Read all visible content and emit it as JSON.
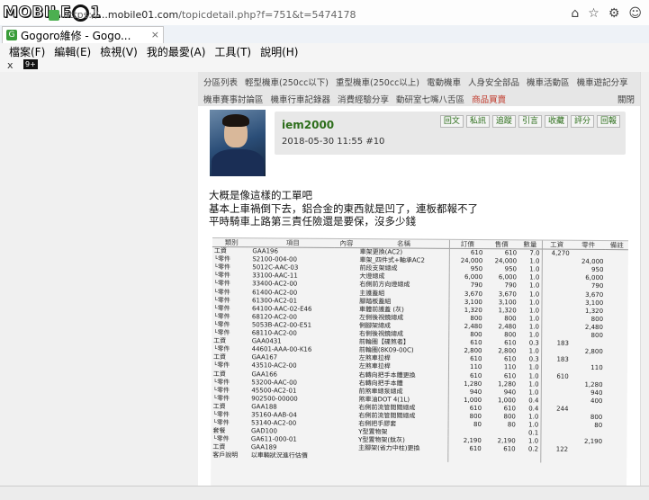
{
  "browser": {
    "logo": {
      "left": "MOBILE",
      "right": "1"
    },
    "url_prefix": "https://",
    "url_domain": "...mobile01.com",
    "url_path": "/topicdetail.php?f=751&t=5474178",
    "tab_title": "Gogoro維修 - Gogo...",
    "tab_close": "×",
    "nav_icons": [
      "home-icon",
      "star-icon",
      "gear-icon",
      "smiley-icon"
    ],
    "menu": [
      "檔案(F)",
      "編輯(E)",
      "檢視(V)",
      "我的最愛(A)",
      "工具(T)",
      "說明(H)"
    ],
    "toolbar_x": "x",
    "toolbar_badge": "9+"
  },
  "forum_nav": {
    "row1": [
      "分區列表",
      "輕型機車(250cc以下)",
      "重型機車(250cc以上)",
      "電動機車",
      "人身安全部品",
      "機車活動區",
      "機車遊記分享"
    ],
    "row2": [
      "機車賽事討論區",
      "機車行車記錄器",
      "消費經驗分享",
      "動研室七嘴八舌區"
    ],
    "row2_highlight": "商品買賣",
    "manage": "關閉"
  },
  "post": {
    "username": "iem2000",
    "datetime": "2018-05-30 11:55",
    "floor": "#10",
    "actions": [
      "回文",
      "私訊",
      "追蹤",
      "引言",
      "收藏",
      "評分",
      "回報"
    ],
    "body": [
      "大概是像這樣的工單吧",
      "基本上車禍倒下去，鋁合金的東西就是凹了，連板都報不了",
      "平時騎車上路第三責任險還是要保，沒多少錢"
    ]
  },
  "scan": {
    "header": [
      "類別",
      "項目",
      "內容",
      "名稱",
      "訂價",
      "售價",
      "數量",
      "工資",
      "零件",
      "備註"
    ],
    "rows": [
      [
        "工資",
        "GAA196",
        "",
        "車架更換(AC2)",
        "610",
        "610",
        "7.0",
        "4,270",
        "",
        ""
      ],
      [
        "└零件",
        "S2100-004-00",
        "",
        "車架_四件式+軸承AC2",
        "24,000",
        "24,000",
        "1.0",
        "",
        "24,000",
        ""
      ],
      [
        "└零件",
        "5012C-AAC-03",
        "",
        "前段支架總成",
        "950",
        "950",
        "1.0",
        "",
        "950",
        ""
      ],
      [
        "└零件",
        "33100-AAC-11",
        "",
        "大燈總成",
        "6,000",
        "6,000",
        "1.0",
        "",
        "6,000",
        ""
      ],
      [
        "└零件",
        "33400-AC2-00",
        "",
        "右側前方向燈總成",
        "790",
        "790",
        "1.0",
        "",
        "790",
        ""
      ],
      [
        "└零件",
        "61400-AC2-00",
        "",
        "主護蓋組",
        "3,670",
        "3,670",
        "1.0",
        "",
        "3,670",
        ""
      ],
      [
        "└零件",
        "61300-AC2-01",
        "",
        "腳踏板蓋組",
        "3,100",
        "3,100",
        "1.0",
        "",
        "3,100",
        ""
      ],
      [
        "└零件",
        "64100-AAC-02-E46",
        "",
        "車體前護蓋 (灰)",
        "1,320",
        "1,320",
        "1.0",
        "",
        "1,320",
        ""
      ],
      [
        "└零件",
        "68120-AC2-00",
        "",
        "左側後視鏡總成",
        "800",
        "800",
        "1.0",
        "",
        "800",
        ""
      ],
      [
        "└零件",
        "5053B-AC2-00-E51",
        "",
        "側腳架總成",
        "2,480",
        "2,480",
        "1.0",
        "",
        "2,480",
        ""
      ],
      [
        "└零件",
        "68110-AC2-00",
        "",
        "右側後視鏡總成",
        "800",
        "800",
        "1.0",
        "",
        "800",
        ""
      ],
      [
        "工資",
        "GAA0431",
        "",
        "前輪圈【碟煞者】",
        "610",
        "610",
        "0.3",
        "183",
        "",
        ""
      ],
      [
        "└零件",
        "44601-AAA-00-K16",
        "",
        "前輪圈(8K09-00C)",
        "2,800",
        "2,800",
        "1.0",
        "",
        "2,800",
        ""
      ],
      [
        "工資",
        "GAA167",
        "",
        "左煞車拉桿",
        "610",
        "610",
        "0.3",
        "183",
        "",
        ""
      ],
      [
        "└零件",
        "43510-AC2-00",
        "",
        "左煞車拉桿",
        "110",
        "110",
        "1.0",
        "",
        "110",
        ""
      ],
      [
        "工資",
        "GAA166",
        "",
        "右轉向把手本體更換",
        "610",
        "610",
        "1.0",
        "610",
        "",
        ""
      ],
      [
        "└零件",
        "53200-AAC-00",
        "",
        "右轉向把手本體",
        "1,280",
        "1,280",
        "1.0",
        "",
        "1,280",
        ""
      ],
      [
        "└零件",
        "45500-AC2-01",
        "",
        "前煞車總泵總成",
        "940",
        "940",
        "1.0",
        "",
        "940",
        ""
      ],
      [
        "└零件",
        "902500-00000",
        "",
        "煞車油DOT 4(1L)",
        "1,000",
        "1,000",
        "0.4",
        "",
        "400",
        ""
      ],
      [
        "工資",
        "GAA188",
        "",
        "右側前流管間關總成",
        "610",
        "610",
        "0.4",
        "244",
        "",
        ""
      ],
      [
        "└零件",
        "35160-AAB-04",
        "",
        "右側前流管間關總成",
        "800",
        "800",
        "1.0",
        "",
        "800",
        ""
      ],
      [
        "└零件",
        "53140-AC2-00",
        "",
        "右側把手膠套",
        "80",
        "80",
        "1.0",
        "",
        "80",
        ""
      ],
      [
        "套餐",
        "GAD100",
        "",
        "Y型置物架",
        "",
        "",
        "0.1",
        "",
        "",
        ""
      ],
      [
        "└零件",
        "GA611-000-01",
        "",
        "Y型置物架(鈦灰)",
        "2,190",
        "2,190",
        "1.0",
        "",
        "2,190",
        ""
      ],
      [
        "工資",
        "GAA189",
        "",
        "主腳架(省力中柱)更換",
        "610",
        "610",
        "0.2",
        "122",
        "",
        ""
      ],
      [
        "客戶說明",
        "以車輛狀況進行估價",
        "",
        "",
        "",
        "",
        "",
        "",
        "",
        ""
      ]
    ]
  }
}
